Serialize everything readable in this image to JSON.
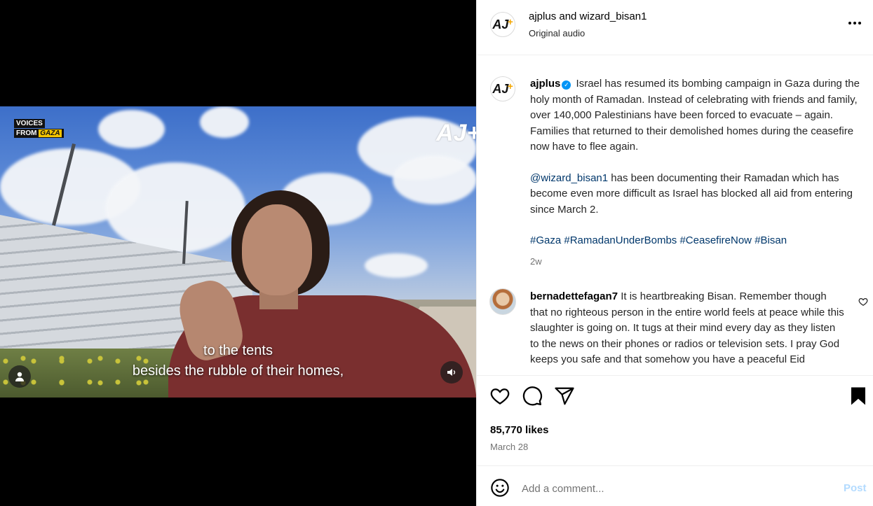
{
  "video": {
    "brand_line1": "VOICES",
    "brand_line2_prefix": "FROM",
    "brand_line2_emph": "GAZA",
    "watermark": "AJ+",
    "subtitle_line1": "to the tents",
    "subtitle_line2": "besides the rubble of their homes,",
    "profile_icon": "user-icon",
    "audio_icon": "speaker-icon"
  },
  "header": {
    "avatar_text": "AJ",
    "title": "ajplus and wizard_bisan1",
    "subtitle": "Original audio",
    "more_icon": "more-icon"
  },
  "caption": {
    "username": "ajplus",
    "verified_badge": "✓",
    "paragraph1": "Israel has resumed its bombing campaign in Gaza during the holy month of Ramadan. Instead of celebrating with friends and family, over 140,000 Palestinians have been forced to evacuate – again. Families that returned to their demolished homes during the ceasefire now have to flee again.",
    "mention": "@wizard_bisan1",
    "paragraph2": " has been documenting their Ramadan which has become even more difficult as Israel has blocked all aid from entering since March 2.",
    "hashtags": [
      "#Gaza",
      "#RamadanUnderBombs",
      "#CeasefireNow",
      "#Bisan"
    ],
    "time_ago": "2w"
  },
  "comment": {
    "username": "bernadettefagan7",
    "text": "It is heartbreaking Bisan. Remember though that no righteous person in the entire world feels at peace while this slaughter is going on. It tugs at their mind every day as they listen to the news on their phones or radios or television sets. I pray God keeps you safe and that somehow you have a peaceful Eid"
  },
  "actions": {
    "icons": [
      "heart-icon",
      "comment-icon",
      "share-icon",
      "bookmark-icon"
    ],
    "likes": "85,770 likes",
    "date": "March 28"
  },
  "comment_bar": {
    "placeholder": "Add a comment...",
    "post_label": "Post",
    "emoji_icon": "emoji-icon"
  },
  "colors": {
    "link": "#00376b",
    "verified": "#0095f6",
    "muted": "#737373",
    "post_disabled": "#b3dbff"
  }
}
